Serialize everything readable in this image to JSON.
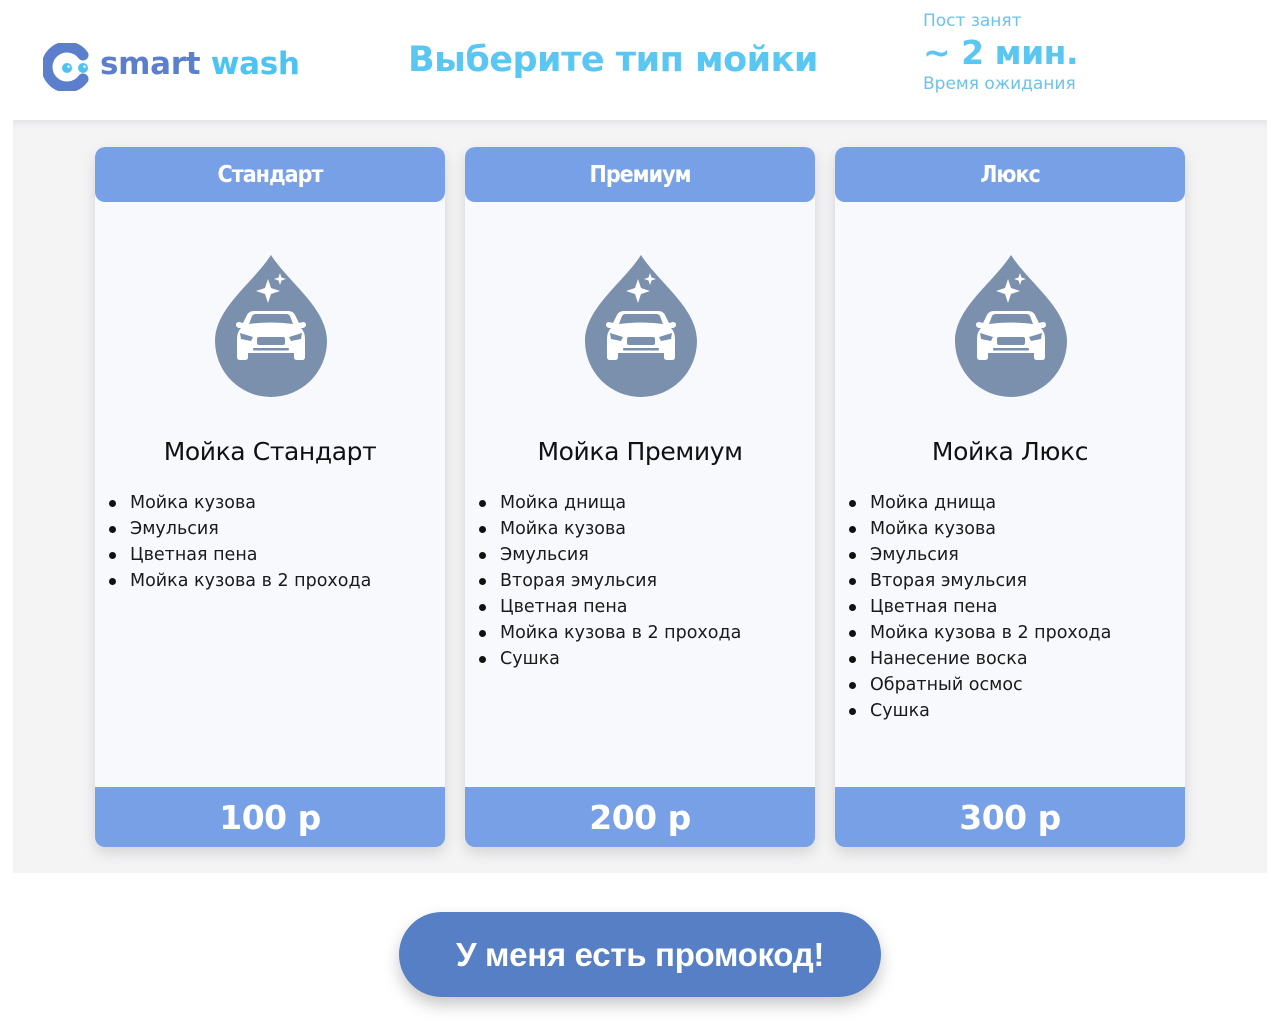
{
  "header": {
    "logo": {
      "word1": "smart",
      "word2": "wash"
    },
    "title": "Выберите тип мойки",
    "status": {
      "top": "Пост занят",
      "wait_value": "~ 2 мин.",
      "bottom": "Время ожидания"
    }
  },
  "colors": {
    "accent_blue": "#78a0e6",
    "title_cyan": "#5ac6f2",
    "button_blue": "#567fc6",
    "icon_gray_blue": "#7a90ad"
  },
  "cards": [
    {
      "tab": "Стандарт",
      "icon": "car-wash-drop-icon",
      "name": "Мойка Стандарт",
      "features": [
        "Мойка кузова",
        "Эмульсия",
        "Цветная пена",
        "Мойка кузова в 2 прохода"
      ],
      "price": "100 р"
    },
    {
      "tab": "Премиум",
      "icon": "car-wash-drop-icon",
      "name": "Мойка Премиум",
      "features": [
        "Мойка днища",
        "Мойка кузова",
        "Эмульсия",
        "Вторая эмульсия",
        "Цветная пена",
        "Мойка кузова в 2 прохода",
        "Сушка"
      ],
      "price": "200 р"
    },
    {
      "tab": "Люкс",
      "icon": "car-wash-drop-icon",
      "name": "Мойка Люкс",
      "features": [
        "Мойка днища",
        "Мойка кузова",
        "Эмульсия",
        "Вторая эмульсия",
        "Цветная пена",
        "Мойка кузова в 2 прохода",
        "Нанесение воска",
        "Обратный осмос",
        "Сушка"
      ],
      "price": "300 р"
    }
  ],
  "promo_button": "У меня есть промокод!"
}
